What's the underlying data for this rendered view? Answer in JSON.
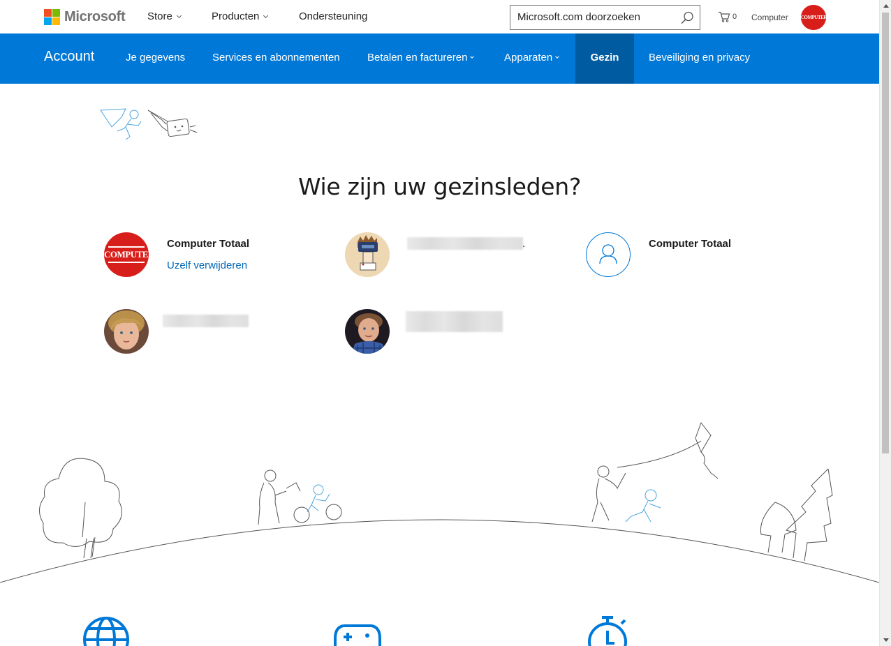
{
  "header": {
    "brand": "Microsoft",
    "nav": [
      {
        "label": "Store",
        "has_dropdown": true
      },
      {
        "label": "Producten",
        "has_dropdown": true
      },
      {
        "label": "Ondersteuning",
        "has_dropdown": false
      }
    ],
    "search_value": "Microsoft.com doorzoeken",
    "cart_count": "0",
    "account_label": "Computer",
    "avatar_logo_text": "COMPUTER!"
  },
  "account_nav": {
    "brand": "Account",
    "items": [
      {
        "label": "Je gegevens",
        "has_dropdown": false
      },
      {
        "label": "Services en abonnementen",
        "has_dropdown": false
      },
      {
        "label": "Betalen en factureren",
        "has_dropdown": true
      },
      {
        "label": "Apparaten",
        "has_dropdown": true
      },
      {
        "label": "Gezin",
        "active": true
      },
      {
        "label": "Beveiliging en privacy",
        "has_dropdown": false
      }
    ]
  },
  "main": {
    "title": "Wie zijn uw gezinsleden?",
    "members": [
      {
        "name": "Computer Totaal",
        "action": "Uzelf verwijderen",
        "avatar": "computer-logo"
      },
      {
        "name": "[redacted]",
        "suffix": ".",
        "avatar": "photo",
        "blurred": true
      },
      {
        "name": "Computer Totaal",
        "avatar": "person-placeholder"
      },
      {
        "name": "[redacted]",
        "avatar": "photo",
        "blurred": true
      },
      {
        "name": "[redacted]",
        "avatar": "photo",
        "blurred": true
      }
    ]
  },
  "colors": {
    "accent": "#0078d7",
    "accent_active": "#005ba1",
    "link": "#0067b8",
    "logo_red": "#d81e1a",
    "ms_red": "#f25022",
    "ms_green": "#7fba00",
    "ms_blue": "#00a4ef",
    "ms_yellow": "#ffb900"
  },
  "icons": [
    "search-icon",
    "cart-icon",
    "chevron-down-icon",
    "person-icon",
    "globe-icon",
    "gamepad-icon",
    "stopwatch-icon"
  ]
}
